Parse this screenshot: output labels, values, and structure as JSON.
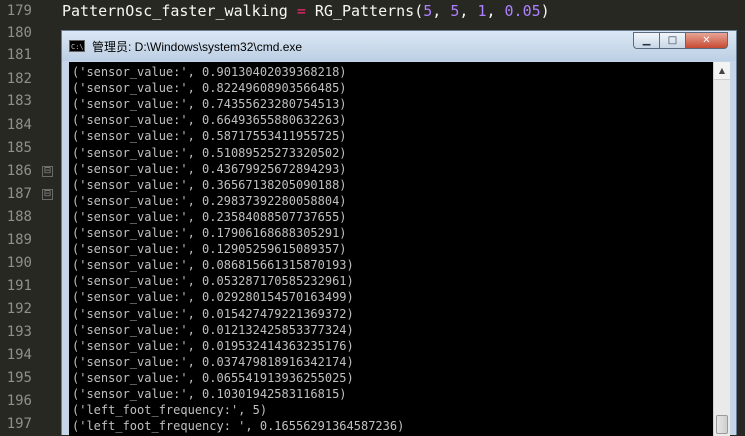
{
  "editor": {
    "line_numbers": [
      "179",
      "180",
      "181",
      "182",
      "183",
      "184",
      "185",
      "186",
      "187",
      "188",
      "189",
      "190",
      "191",
      "192",
      "193",
      "194",
      "195",
      "196",
      "197"
    ],
    "code_line_179": {
      "var": "PatternOsc_faster_walking",
      "op": "=",
      "fn": "RG_Patterns(",
      "a1": "5",
      "c1": ", ",
      "a2": "5",
      "c2": ", ",
      "a3": "1",
      "c3": ", ",
      "a4": "0.05",
      "close": ")"
    },
    "fold_markers": [
      "⊟",
      "⊟"
    ]
  },
  "cmd_window": {
    "title": "管理员: D:\\Windows\\system32\\cmd.exe",
    "icon_text": "C:\\",
    "buttons": {
      "minimize": "▁",
      "maximize": "□",
      "close": "✕"
    },
    "scroll_up": "▲",
    "output_lines": [
      "('sensor_value:', 0.90130402039368218)",
      "('sensor_value:', 0.82249608903566485)",
      "('sensor_value:', 0.74355623280754513)",
      "('sensor_value:', 0.66493655880632263)",
      "('sensor_value:', 0.58717553411955725)",
      "('sensor_value:', 0.51089525273320502)",
      "('sensor_value:', 0.43679925672894293)",
      "('sensor_value:', 0.36567138205090188)",
      "('sensor_value:', 0.29837392280058804)",
      "('sensor_value:', 0.23584088507737655)",
      "('sensor_value:', 0.17906168688305291)",
      "('sensor_value:', 0.12905259615089357)",
      "('sensor_value:', 0.086815661315870193)",
      "('sensor_value:', 0.053287170585232961)",
      "('sensor_value:', 0.029280154570163499)",
      "('sensor_value:', 0.015427479221369372)",
      "('sensor_value:', 0.012132425853377324)",
      "('sensor_value:', 0.019532414363235176)",
      "('sensor_value:', 0.037479818916342174)",
      "('sensor_value:', 0.065541913936255025)",
      "('sensor_value:', 0.10301942583116815)",
      "('left_foot_frequency:', 5)",
      "('left_foot_frequency: ', 0.16556291364587236)"
    ]
  }
}
